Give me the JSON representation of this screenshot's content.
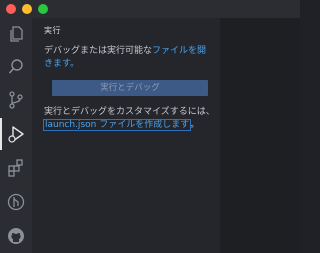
{
  "window": {
    "traffic_lights": {
      "close": "#fe5f57",
      "minimize": "#febc2e",
      "zoom": "#28c840"
    }
  },
  "activity_bar": {
    "items": [
      {
        "icon": "files-icon"
      },
      {
        "icon": "search-icon"
      },
      {
        "icon": "source-control-icon"
      },
      {
        "icon": "run-debug-icon",
        "active": true
      },
      {
        "icon": "extensions-icon"
      },
      {
        "icon": "remote-icon"
      },
      {
        "icon": "github-icon"
      }
    ]
  },
  "sidebar": {
    "title": "実行",
    "open_file_text": "デバッグまたは実行可能な",
    "open_file_link": "ファイルを開きます",
    "open_file_suffix": "。",
    "run_button_label": "実行とデバッグ",
    "customize_text": "実行とデバッグをカスタマイズするには、",
    "create_launch_link": "launch.json ファイルを作成します",
    "create_launch_suffix": "。"
  }
}
